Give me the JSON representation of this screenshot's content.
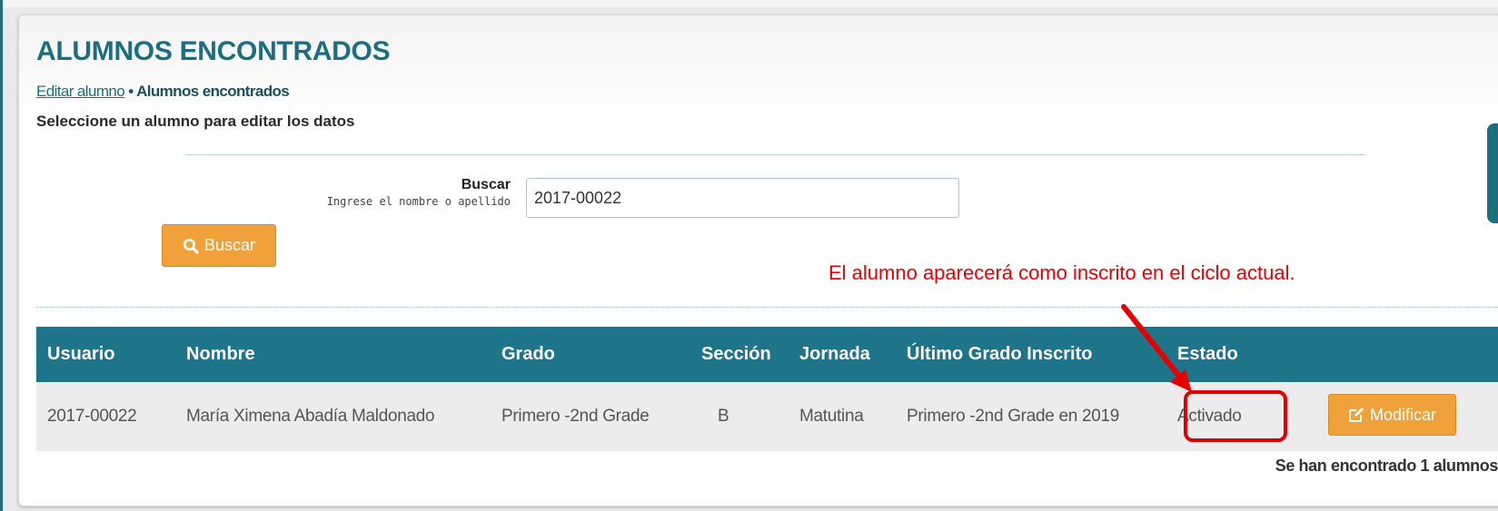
{
  "page": {
    "title": "ALUMNOS ENCONTRADOS",
    "breadcrumb": {
      "link": "Editar alumno",
      "separator": "•",
      "current": "Alumnos encontrados"
    },
    "subtitle": "Seleccione un alumno para editar los datos"
  },
  "search": {
    "label": "Buscar",
    "hint": "Ingrese el nombre o apellido",
    "value": "2017-00022",
    "button_label": "Buscar",
    "button_icon": "search-icon"
  },
  "annotation": {
    "text": "El alumno aparecerá como inscrito en el ciclo actual.",
    "color": "#e60000"
  },
  "table": {
    "headers": [
      "Usuario",
      "Nombre",
      "Grado",
      "Sección",
      "Jornada",
      "Último Grado Inscrito",
      "Estado"
    ],
    "rows": [
      {
        "usuario": "2017-00022",
        "nombre": "María Ximena Abadía Maldonado",
        "grado": "Primero -2nd Grade",
        "seccion": "B",
        "jornada": "Matutina",
        "ultimo_grado": "Primero -2nd Grade en 2019",
        "estado": "Activado",
        "action_label": "Modificar",
        "action_icon": "edit-icon"
      }
    ],
    "footer": "Se han encontrado 1 alumnos"
  },
  "colors": {
    "accent": "#1e7488",
    "button": "#f0a13a",
    "highlight": "#e00000"
  }
}
